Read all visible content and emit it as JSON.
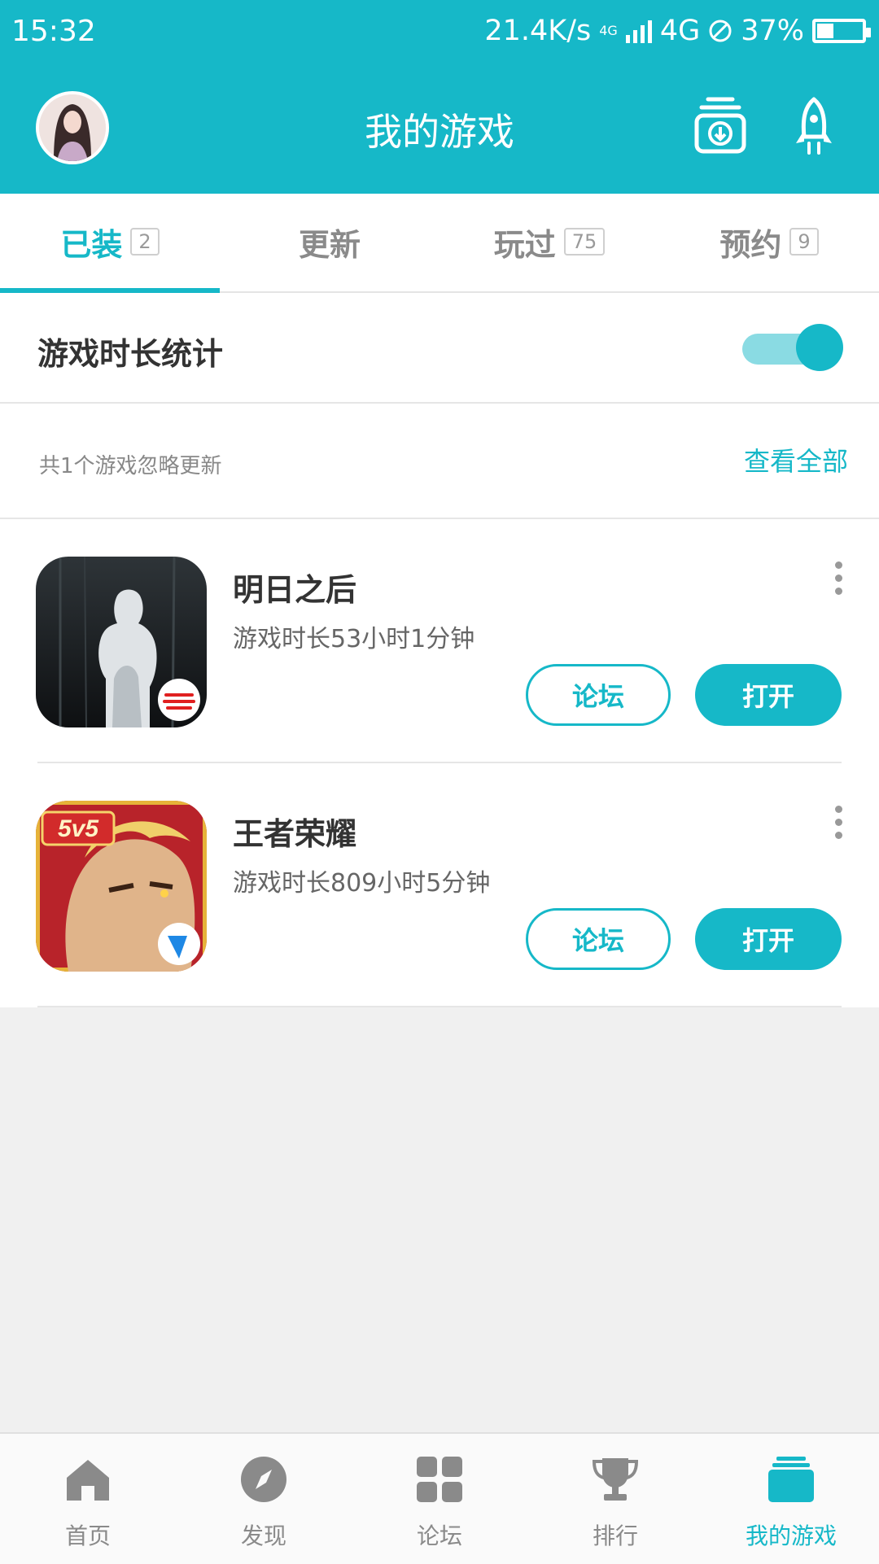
{
  "status_bar": {
    "time": "15:32",
    "speed": "21.4K/s",
    "net_small": "4G",
    "network": "4G",
    "battery": "37%"
  },
  "header": {
    "title": "我的游戏",
    "icons": [
      "avatar",
      "download-manager-icon",
      "rocket-icon"
    ]
  },
  "tabs": [
    {
      "label": "已装",
      "count": "2"
    },
    {
      "label": "更新",
      "count": ""
    },
    {
      "label": "玩过",
      "count": "75"
    },
    {
      "label": "预约",
      "count": "9"
    }
  ],
  "stats": {
    "label": "游戏时长统计",
    "toggle_on": true
  },
  "ignore": {
    "text": "共1个游戏忽略更新",
    "view_all": "查看全部"
  },
  "games": [
    {
      "name": "明日之后",
      "playtime": "游戏时长53小时1分钟",
      "forum_label": "论坛",
      "open_label": "打开"
    },
    {
      "name": "王者荣耀",
      "playtime": "游戏时长809小时5分钟",
      "forum_label": "论坛",
      "open_label": "打开",
      "icon_badge": "5v5"
    }
  ],
  "bottom_nav": [
    {
      "label": "首页",
      "icon": "home-icon"
    },
    {
      "label": "发现",
      "icon": "compass-icon"
    },
    {
      "label": "论坛",
      "icon": "grid-icon"
    },
    {
      "label": "排行",
      "icon": "trophy-icon"
    },
    {
      "label": "我的游戏",
      "icon": "stack-icon"
    }
  ],
  "colors": {
    "accent": "#16b8c8",
    "nav_inactive": "#8a8a8a"
  }
}
